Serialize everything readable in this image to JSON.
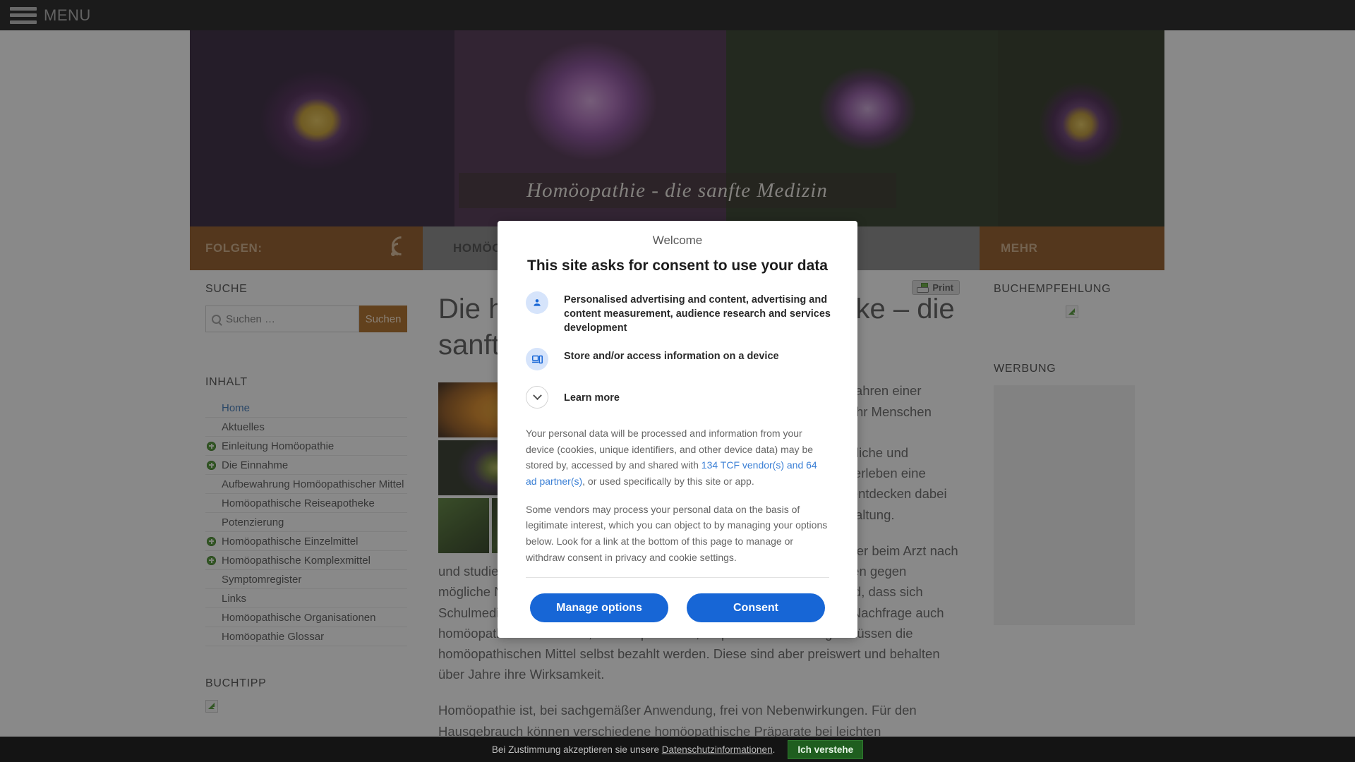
{
  "topbar": {
    "menu_label": "MENU",
    "menu_icon": "hamburger-icon"
  },
  "hero": {
    "overlay_title": "Homöopathie - die sanfte Medizin"
  },
  "bars": {
    "follow_label": "FOLGEN:",
    "follow_icon": "rss-icon",
    "nav_label": "HOMÖOPATHIE",
    "more_label": "MEHR"
  },
  "sidebar_left": {
    "search_title": "SUCHE",
    "search_placeholder": "Suchen …",
    "search_value": "",
    "search_button": "Suchen",
    "content_title": "INHALT",
    "items": [
      {
        "label": "Home",
        "expandable": false,
        "active": true
      },
      {
        "label": "Aktuelles",
        "expandable": false,
        "active": false
      },
      {
        "label": "Einleitung Homöopathie",
        "expandable": true,
        "active": false
      },
      {
        "label": "Die Einnahme",
        "expandable": true,
        "active": false
      },
      {
        "label": "Aufbewahrung Homöopathischer Mittel",
        "expandable": false,
        "active": false
      },
      {
        "label": "Homöopathische Reiseapotheke",
        "expandable": false,
        "active": false
      },
      {
        "label": "Potenzierung",
        "expandable": false,
        "active": false
      },
      {
        "label": "Homöopathische Einzelmittel",
        "expandable": true,
        "active": false
      },
      {
        "label": "Homöopathische Komplexmittel",
        "expandable": true,
        "active": false
      },
      {
        "label": "Symptomregister",
        "expandable": false,
        "active": false
      },
      {
        "label": "Links",
        "expandable": false,
        "active": false
      },
      {
        "label": "Homöopathische Organisationen",
        "expandable": false,
        "active": false
      },
      {
        "label": "Homöopathie Glossar",
        "expandable": false,
        "active": false
      }
    ],
    "book_title": "BUCHTIPP",
    "book_image_icon": "broken-image-icon"
  },
  "main": {
    "print_label": "Print",
    "print_icon": "printer-icon",
    "title": "Die homöopathische Hausapotheke – die sanfte Medizin",
    "paragraphs": [
      "Die Homöopathie erfreut sich seit Jahren einer wachsenden Beliebtheit. Immer mehr Menschen fragen nach sanften Alternativen im Gesundheitsbereich. Naturheilkundliche und erfahrungsheilkundliche Verfahren erleben eine Renaissance und viele Menschen entdecken dabei auch die Selbsthilfe zur Gesunderhaltung.",
      "Viele Patienten fragen heute genauer beim Arzt nach und studieren die Beipackzettel von Medikamenten. Beschwerden werden gegen mögliche Nebenwirkungen abgewogen. Vielleicht ist dies auch der Grund, dass sich Schulmediziner den alternativen Heilmethoden langsam öffnen und auf Nachfrage auch homöopathische Arzneien, oft Komplexmittel, empfehlen. In der Regel müssen die homöopathischen Mittel selbst bezahlt werden. Diese sind aber preiswert und behalten über Jahre ihre Wirksamkeit.",
      "Homöopathie ist, bei sachgemäßer Anwendung, frei von Nebenwirkungen. Für den Hausgebrauch können verschiedene homöopathische Präparate bei leichten"
    ]
  },
  "sidebar_right": {
    "book_title": "BUCHEMPFEHLUNG",
    "book_image_icon": "broken-image-icon",
    "ad_title": "WERBUNG"
  },
  "consent_dialog": {
    "welcome": "Welcome",
    "heading": "This site asks for consent to use your data",
    "purposes": [
      {
        "icon": "person-icon",
        "text": "Personalised advertising and content, advertising and content measurement, audience research and services development"
      },
      {
        "icon": "device-icon",
        "text": "Store and/or access information on a device"
      }
    ],
    "learn_more": "Learn more",
    "learn_more_icon": "chevron-down-icon",
    "paragraph_1_pre": "Your personal data will be processed and information from your device (cookies, unique identifiers, and other device data) may be stored by, accessed by and shared with ",
    "paragraph_1_link": "134 TCF vendor(s) and 64 ad partner(s)",
    "paragraph_1_post": ", or used specifically by this site or app.",
    "paragraph_2": "Some vendors may process your personal data on the basis of legitimate interest, which you can object to by managing your options below. Look for a link at the bottom of this page to manage or withdraw consent in privacy and cookie settings.",
    "manage_button": "Manage options",
    "consent_button": "Consent"
  },
  "cookie_bar": {
    "text_pre": "Bei Zustimmung akzeptieren sie unsere ",
    "link": "Datenschutzinformationen",
    "text_post": ".",
    "button": "Ich verstehe"
  },
  "colors": {
    "accent_brown": "#8a4a10",
    "dialog_blue": "#1766d6",
    "link_blue": "#3a7fd5",
    "cookie_green": "#1f5e1f",
    "nav_plus_green": "#3f8f1f"
  }
}
